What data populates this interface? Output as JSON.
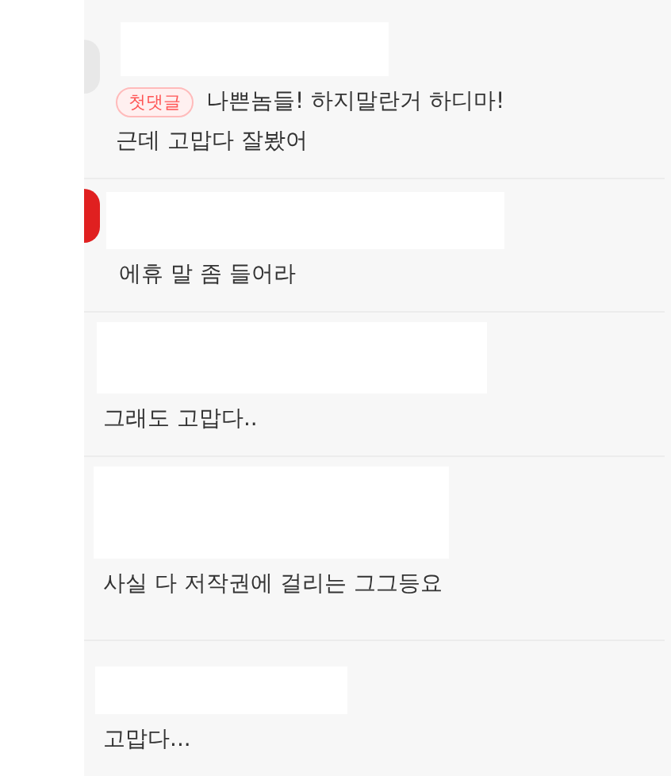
{
  "comments": [
    {
      "badge": "첫댓글",
      "text": "나쁜놈들! 하지말란거 하디마!",
      "text_2": "근데 고맙다 잘봤어",
      "color": "#e8e8e8"
    },
    {
      "text": "에휴 말 좀 들어라",
      "color": "#e02020"
    },
    {
      "text": "그래도 고맙다.."
    },
    {
      "text": "사실 다 저작권에 걸리는 그그등요"
    },
    {
      "text": "고맙다..."
    }
  ]
}
